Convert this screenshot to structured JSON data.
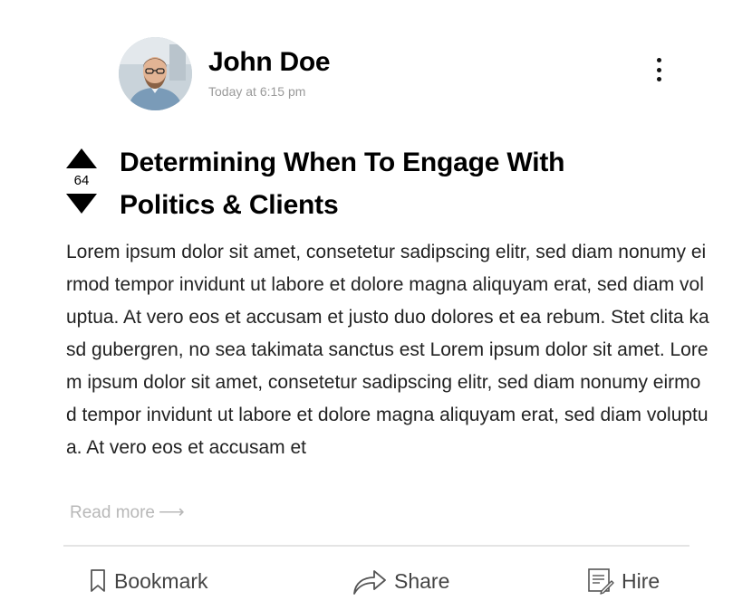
{
  "author": {
    "name": "John Doe",
    "timestamp": "Today at 6:15 pm",
    "avatar_icon": "user-photo-avatar"
  },
  "menu": {
    "icon": "more-vertical-icon"
  },
  "post": {
    "votes": "64",
    "title": "Determining When To Engage With Politics & Clients",
    "body": "Lorem ipsum dolor sit amet, consetetur sadipscing elitr, sed diam nonumy eirmod tempor invidunt ut labore et dolore magna aliquyam erat, sed diam voluptua. At vero eos et accusam et justo duo dolores et ea rebum. Stet clita kasd gubergren, no sea takimata sanctus est Lorem ipsum dolor sit amet. Lorem ipsum dolor sit amet, consetetur sadipscing elitr, sed diam nonumy eirmod tempor invidunt ut labore et dolore magna aliquyam erat, sed diam voluptua. At vero eos et accusam et",
    "read_more": "Read more"
  },
  "actions": {
    "bookmark": {
      "label": "Bookmark",
      "icon": "bookmark-icon"
    },
    "share": {
      "label": "Share",
      "icon": "share-arrow-icon"
    },
    "hire": {
      "label": "Hire",
      "icon": "hire-document-icon"
    }
  },
  "colors": {
    "text_primary": "#000000",
    "text_body": "#222222",
    "text_muted": "#9a9a9a",
    "divider": "#e4e4e4"
  }
}
